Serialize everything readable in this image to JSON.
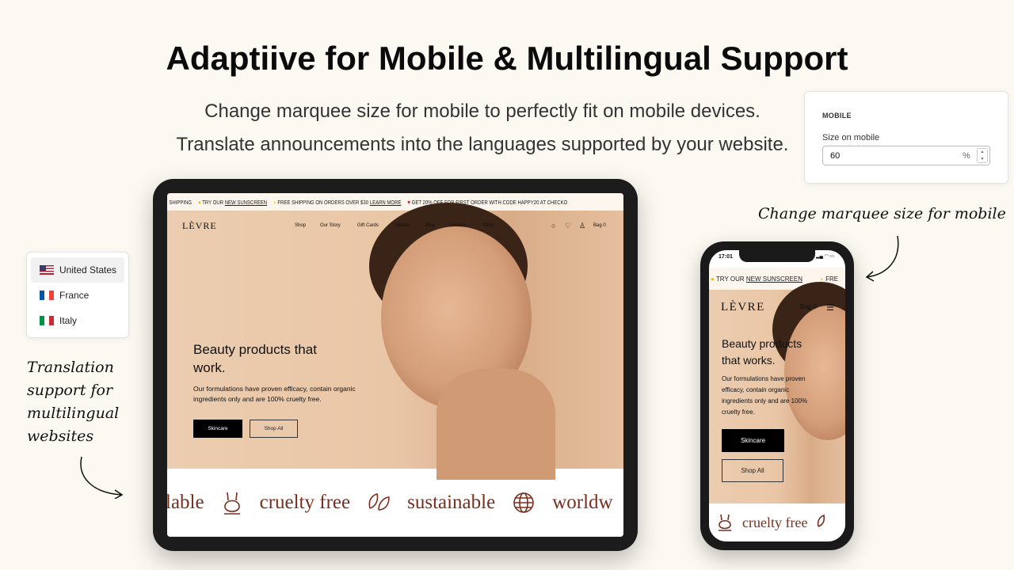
{
  "header": {
    "title": "Adaptiive for Mobile & Multilingual Support",
    "line1": "Change marquee size for mobile to perfectly fit on mobile devices.",
    "line2": "Translate announcements into the languages supported by your website."
  },
  "settings": {
    "section": "MOBILE",
    "label": "Size on mobile",
    "value": "60",
    "unit": "%"
  },
  "languages": [
    {
      "label": "United States",
      "flag": "us"
    },
    {
      "label": "France",
      "flag": "fr"
    },
    {
      "label": "Italy",
      "flag": "it"
    }
  ],
  "notes": {
    "left": [
      "Translation",
      "support for",
      "multilingual",
      "websites"
    ],
    "right": "Change marquee size for mobile"
  },
  "tablet": {
    "announcements": [
      "SHIPPING",
      "TRY OUR",
      "NEW SUNSCREEN",
      "FREE SHIPPING ON ORDERS OVER $30",
      "LEARN MORE",
      "GET 20% OFF FOR FIRST ORDER WITH CODE HAPPY20 AT CHECKO"
    ],
    "logo": "LÈVRE",
    "nav": [
      "Shop",
      "Our Story",
      "Gift Cards",
      "Values",
      "Blog",
      "Contact",
      "Other"
    ],
    "bag": "Bag 0",
    "heading": "Beauty products that work.",
    "body": "Our formulations have proven efficacy, contain organic ingredients only and are 100% cruelty free.",
    "btn1": "Skincare",
    "btn2": "Shop All",
    "marquee": [
      "lable",
      "cruelty free",
      "sustainable",
      "worldw"
    ]
  },
  "phone": {
    "time": "17:01",
    "announce1": "TRY OUR",
    "announce_link": "NEW SUNSCREEN",
    "announce2": "FRE",
    "logo": "LÈVRE",
    "bag": "Bag 0",
    "heading": "Beauty products that works.",
    "body": "Our formulations have proven efficacy, contain organic ingredients only and are 100% cruelty free.",
    "btn1": "Skincare",
    "btn2": "Shop All",
    "marquee": "cruelty free"
  },
  "colors": {
    "background": "#fcf8f2",
    "marquee_text": "#7a2e1e",
    "hero": "#eccdb0"
  }
}
